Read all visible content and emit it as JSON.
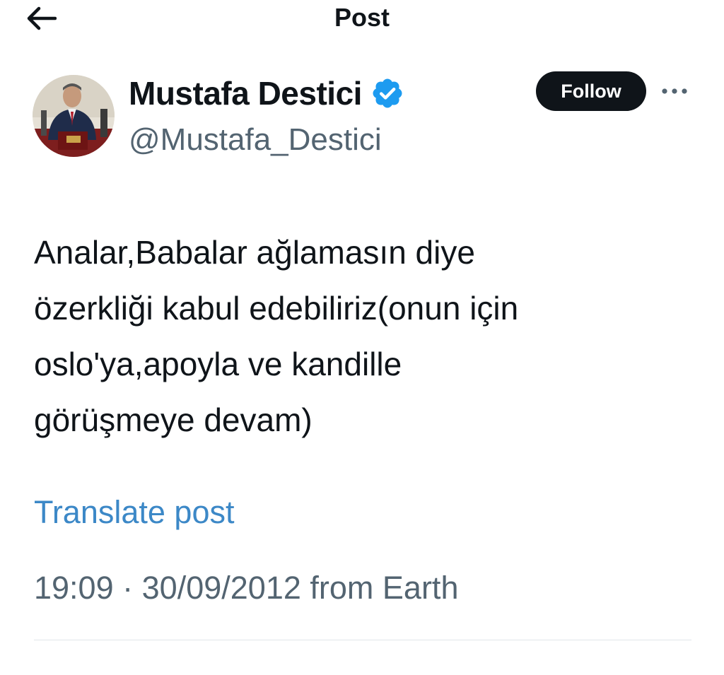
{
  "header": {
    "title": "Post",
    "back_icon": "arrow-left-icon"
  },
  "author": {
    "name": "Mustafa Destici",
    "handle": "@Mustafa_Destici",
    "verified_icon": "verified-badge-icon",
    "verified_color": "#1d9bf0"
  },
  "actions": {
    "follow_label": "Follow",
    "more_icon": "more-horizontal-icon"
  },
  "post": {
    "lines": [
      "Analar,Babalar ağlamasın diye",
      "özerkliği kabul edebiliriz(onun için",
      "oslo'ya,apoyla ve kandille",
      "görüşmeye devam)"
    ],
    "translate_label": "Translate post",
    "time": "19:09",
    "separator": "·",
    "date": "30/09/2012",
    "source": "from Earth"
  },
  "colors": {
    "text": "#0f1419",
    "secondary": "#536471",
    "link": "#3c88c7",
    "follow_bg": "#0f1419"
  }
}
